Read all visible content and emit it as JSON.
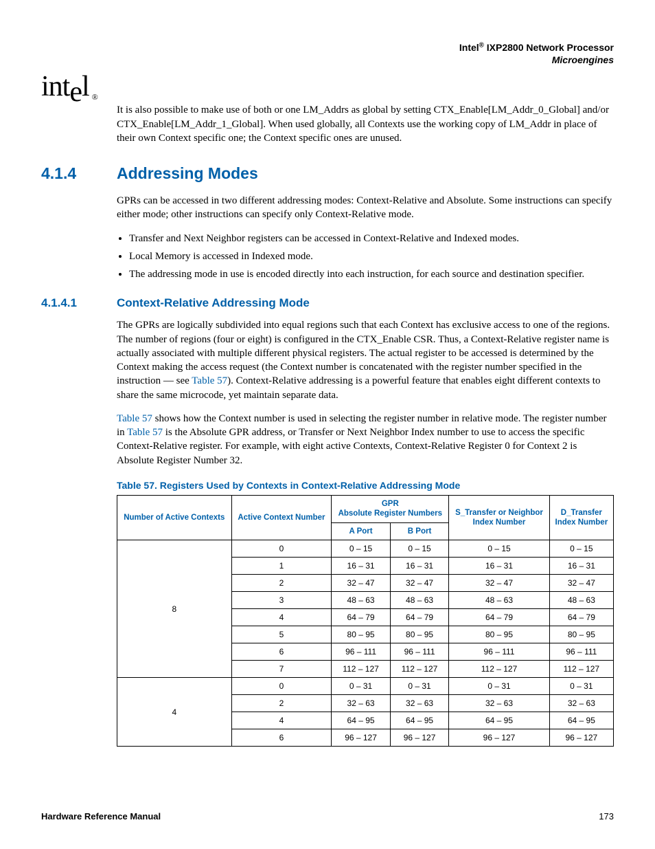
{
  "header": {
    "brand": "Intel",
    "reg": "®",
    "product": " IXP2800 Network Processor",
    "subtitle": "Microengines"
  },
  "logo": {
    "text_a": "int",
    "text_b": "e",
    "text_c": "l",
    "reg": "®"
  },
  "intro_para": "It is also possible to make use of both or one LM_Addrs as global by setting CTX_Enable[LM_Addr_0_Global] and/or CTX_Enable[LM_Addr_1_Global]. When used globally, all Contexts use the working copy of LM_Addr in place of their own Context specific one; the Context specific ones are unused.",
  "h2": {
    "num": "4.1.4",
    "title": "Addressing Modes"
  },
  "para2": "GPRs can be accessed in two different addressing modes: Context-Relative and Absolute. Some instructions can specify either mode; other instructions can specify only Context-Relative mode.",
  "bullets": [
    "Transfer and Next Neighbor registers can be accessed in Context-Relative and Indexed modes.",
    "Local Memory is accessed in Indexed mode.",
    "The addressing mode in use is encoded directly into each instruction, for each source and destination specifier."
  ],
  "h3": {
    "num": "4.1.4.1",
    "title": "Context-Relative Addressing Mode"
  },
  "para3a": "The GPRs are logically subdivided into equal regions such that each Context has exclusive access to one of the regions. The number of regions (four or eight) is configured in the CTX_Enable CSR. Thus, a Context-Relative register name is actually associated with multiple different physical registers. The actual register to be accessed is determined by the Context making the access request (the Context number is concatenated with the register number specified in the instruction — see ",
  "para3_xref": "Table 57",
  "para3b": "). Context-Relative addressing is a powerful feature that enables eight different contexts to share the same microcode, yet maintain separate data.",
  "para4a": "Table 57",
  "para4b": " shows how the Context number is used in selecting the register number in relative mode. The register number in ",
  "para4c": "Table 57",
  "para4d": " is the Absolute GPR address, or Transfer or Next Neighbor Index number to use to access the specific Context-Relative register. For example, with eight active Contexts, Context-Relative Register 0 for Context 2 is Absolute Register Number 32.",
  "table_caption": "Table 57. Registers Used by Contexts in Context-Relative Addressing Mode",
  "table_headers": {
    "col1": "Number of Active Contexts",
    "col2": "Active Context Number",
    "gpr_top": "GPR",
    "gpr_sub": "Absolute Register Numbers",
    "aport": "A Port",
    "bport": "B Port",
    "col5": "S_Transfer or Neighbor",
    "col5b": "Index Number",
    "col6": "D_Transfer",
    "col6b": "Index Number"
  },
  "chart_data": {
    "type": "table",
    "groups": [
      {
        "active_contexts": "8",
        "rows": [
          {
            "ctx": "0",
            "a": "0 – 15",
            "b": "0 – 15",
            "s": "0 – 15",
            "d": "0 – 15"
          },
          {
            "ctx": "1",
            "a": "16 – 31",
            "b": "16 – 31",
            "s": "16 – 31",
            "d": "16 – 31"
          },
          {
            "ctx": "2",
            "a": "32 – 47",
            "b": "32 – 47",
            "s": "32 – 47",
            "d": "32 – 47"
          },
          {
            "ctx": "3",
            "a": "48 – 63",
            "b": "48 – 63",
            "s": "48 – 63",
            "d": "48 – 63"
          },
          {
            "ctx": "4",
            "a": "64 – 79",
            "b": "64 – 79",
            "s": "64 – 79",
            "d": "64 – 79"
          },
          {
            "ctx": "5",
            "a": "80 – 95",
            "b": "80 – 95",
            "s": "80 – 95",
            "d": "80 – 95"
          },
          {
            "ctx": "6",
            "a": "96 – 111",
            "b": "96 – 111",
            "s": "96 – 111",
            "d": "96 – 111"
          },
          {
            "ctx": "7",
            "a": "112 – 127",
            "b": "112 – 127",
            "s": "112 – 127",
            "d": "112 – 127"
          }
        ]
      },
      {
        "active_contexts": "4",
        "rows": [
          {
            "ctx": "0",
            "a": "0 – 31",
            "b": "0 – 31",
            "s": "0 – 31",
            "d": "0 – 31"
          },
          {
            "ctx": "2",
            "a": "32 – 63",
            "b": "32 – 63",
            "s": "32 – 63",
            "d": "32 – 63"
          },
          {
            "ctx": "4",
            "a": "64 – 95",
            "b": "64 – 95",
            "s": "64 – 95",
            "d": "64 – 95"
          },
          {
            "ctx": "6",
            "a": "96 – 127",
            "b": "96 – 127",
            "s": "96 – 127",
            "d": "96 – 127"
          }
        ]
      }
    ]
  },
  "footer": {
    "left": "Hardware Reference Manual",
    "right": "173"
  }
}
